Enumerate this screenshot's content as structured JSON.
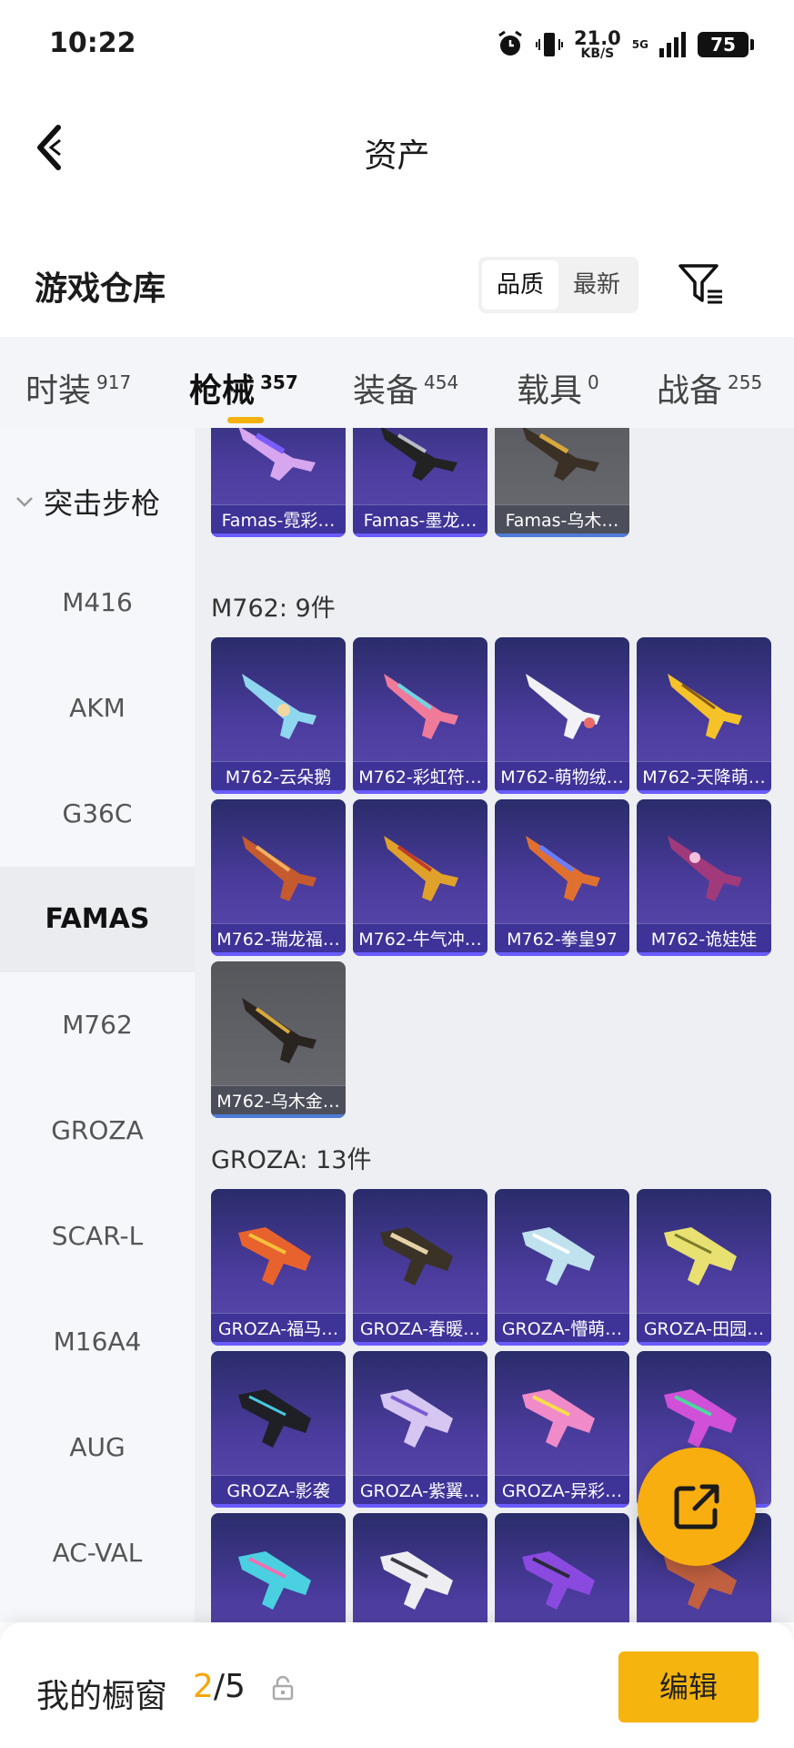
{
  "status_bar": {
    "time": "10:22",
    "speed_value": "21.0",
    "speed_unit": "KB/S",
    "network": "5G",
    "battery": "75"
  },
  "nav": {
    "title": "资产"
  },
  "header": {
    "title": "游戏仓库",
    "sort_quality": "品质",
    "sort_latest": "最新"
  },
  "tabs": [
    {
      "label": "时装",
      "count": "917"
    },
    {
      "label": "枪械",
      "count": "357"
    },
    {
      "label": "装备",
      "count": "454"
    },
    {
      "label": "载具",
      "count": "0"
    },
    {
      "label": "战备",
      "count": "255"
    }
  ],
  "sidebar": {
    "category": "突击步枪",
    "items": [
      "M416",
      "AKM",
      "G36C",
      "FAMAS",
      "M762",
      "GROZA",
      "SCAR-L",
      "M16A4",
      "AUG",
      "AC-VAL"
    ]
  },
  "groups": {
    "famas_cards": [
      "Famas-霓彩…",
      "Famas-墨龙…",
      "Famas-乌木…"
    ],
    "m762_title": "M762: 9件",
    "m762_cards": [
      "M762-云朵鹅",
      "M762-彩虹符…",
      "M762-萌物绒…",
      "M762-天降萌…",
      "M762-瑞龙福…",
      "M762-牛气冲…",
      "M762-拳皇97",
      "M762-诡娃娃",
      "M762-乌木金…"
    ],
    "groza_title": "GROZA: 13件",
    "groza_cards": [
      "GROZA-福马…",
      "GROZA-春暖…",
      "GROZA-懵萌…",
      "GROZA-田园…",
      "GROZA-影袭",
      "GROZA-紫翼…",
      "GROZA-异彩…"
    ]
  },
  "bottom_bar": {
    "label": "我的橱窗",
    "current": "2",
    "total": "/5",
    "edit": "编辑"
  },
  "colors": {
    "accent": "#f5b20e",
    "card_purple": "#4b3c9e",
    "card_gray": "#5e6066"
  }
}
